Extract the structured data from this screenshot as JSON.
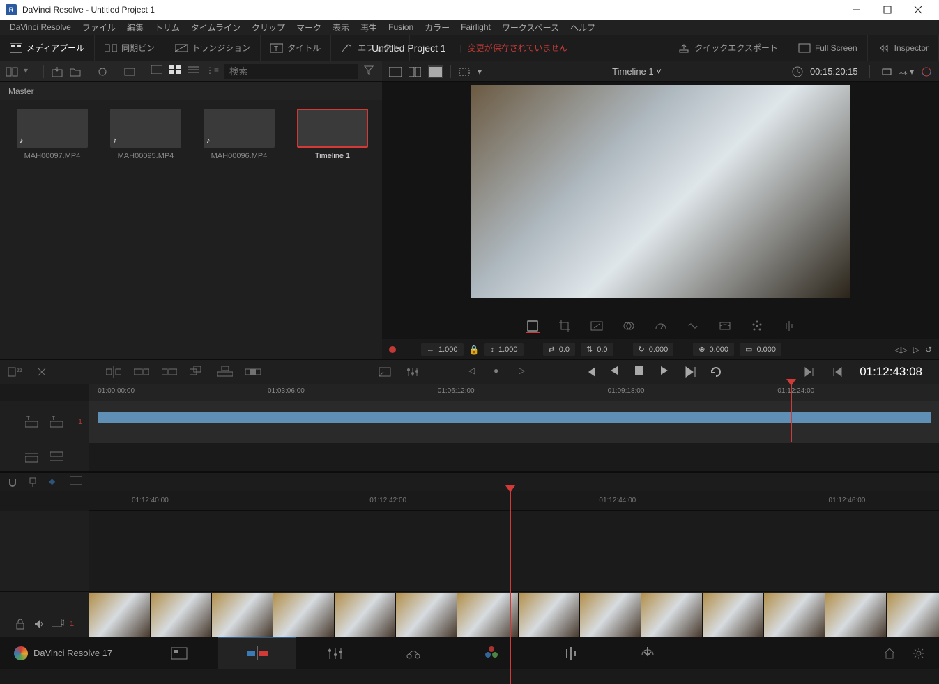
{
  "window": {
    "title": "DaVinci Resolve - Untitled Project 1"
  },
  "menus": [
    "DaVinci Resolve",
    "ファイル",
    "編集",
    "トリム",
    "タイムライン",
    "クリップ",
    "マーク",
    "表示",
    "再生",
    "Fusion",
    "カラー",
    "Fairlight",
    "ワークスペース",
    "ヘルプ"
  ],
  "toolbar": {
    "media_pool": "メディアプール",
    "sync_bin": "同期ビン",
    "transition": "トランジション",
    "title": "タイトル",
    "effect": "エフェクト",
    "project": "Untitled Project 1",
    "unsaved": "変更が保存されていません",
    "quick_export": "クイックエクスポート",
    "full_screen": "Full Screen",
    "inspector": "Inspector"
  },
  "media": {
    "master": "Master",
    "search_placeholder": "検索",
    "clips": [
      {
        "name": "MAH00097.MP4",
        "selected": false
      },
      {
        "name": "MAH00095.MP4",
        "selected": false
      },
      {
        "name": "MAH00096.MP4",
        "selected": false
      },
      {
        "name": "Timeline 1",
        "selected": true
      }
    ]
  },
  "viewer": {
    "timeline_name": "Timeline 1",
    "duration": "00:15:20:15",
    "transform": {
      "zoom_w": "1.000",
      "zoom_h": "1.000",
      "pos_x": "0.0",
      "pos_y": "0.0",
      "rot": "0.000",
      "anchor_x": "0.000",
      "anchor_y": "0.000"
    }
  },
  "transport": {
    "timecode": "01:12:43:08"
  },
  "overview_ruler": [
    "01:00:00:00",
    "01:03:06:00",
    "01:06:12:00",
    "01:09:18:00",
    "01:12:24:00"
  ],
  "overview_track_num": "1",
  "detail_ruler": [
    "01:12:40:00",
    "01:12:42:00",
    "01:12:44:00",
    "01:12:46:00"
  ],
  "video_track_num": "1",
  "brand": "DaVinci Resolve 17"
}
